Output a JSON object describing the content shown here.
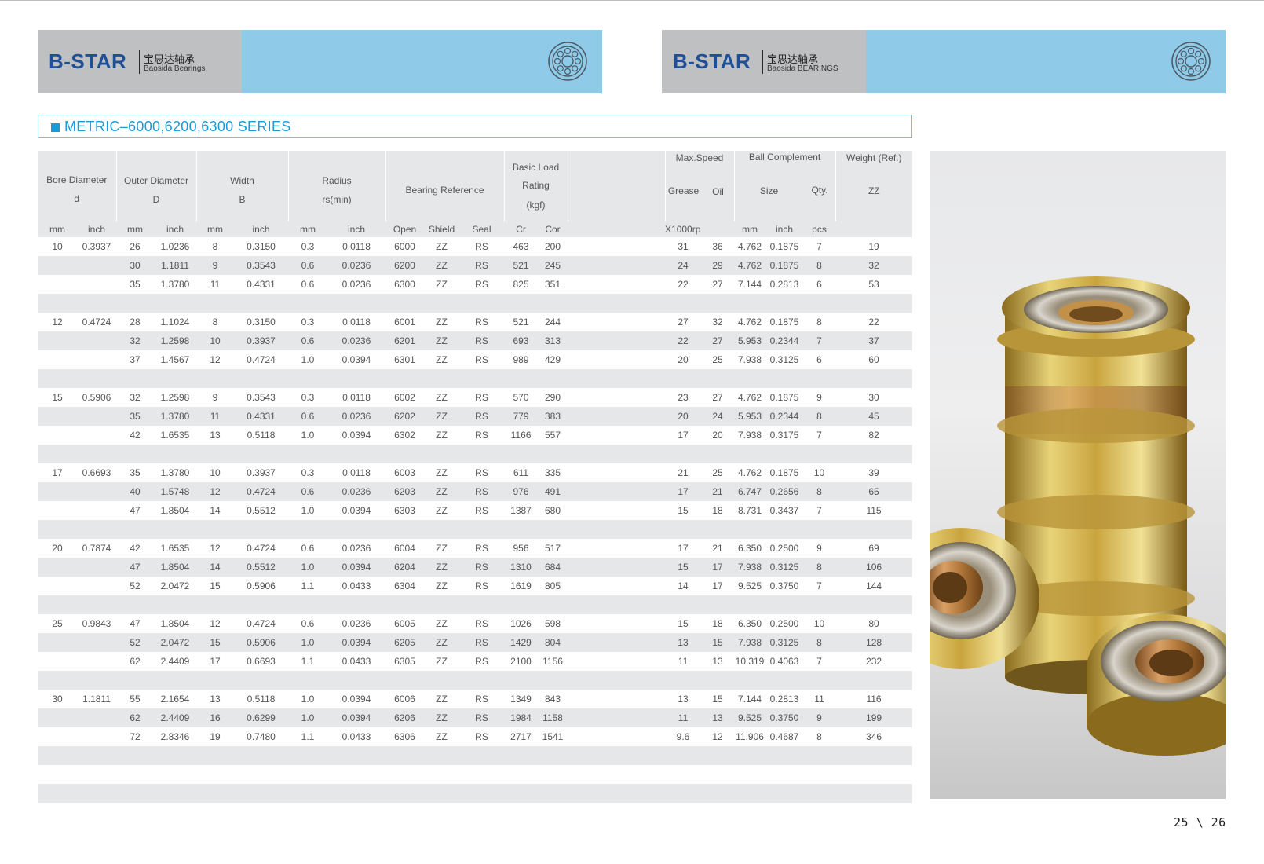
{
  "left_header": {
    "brand": "B-STAR",
    "cn": "宝思达轴承",
    "en": "Baosida Bearings"
  },
  "right_header": {
    "brand": "B-STAR",
    "cn": "宝思达轴承",
    "en": "Baosida BEARINGS"
  },
  "title": "METRIC–6000,6200,6300 SERIES",
  "colors": {
    "accent": "#1c9ad6",
    "header_blue": "#8fcbe8",
    "header_grey": "#bfc0c2",
    "row_grey": "#e6e7e8"
  },
  "headers": {
    "bore": [
      "Bore  Diameter",
      "d"
    ],
    "outer": [
      "Outer Diameter",
      "D"
    ],
    "width": [
      "Width",
      "B"
    ],
    "radius": [
      "Radius",
      "rs(min)"
    ],
    "reference": "Bearing Reference",
    "load": [
      "Basic Load",
      "Rating",
      "(kgf)"
    ],
    "maxspeed": "Max.Speed",
    "grease": "Grease",
    "oil": "Oil",
    "ballcomp": "Ball Complement",
    "size": "Size",
    "qty": "Qty.",
    "weight": "Weight  (Ref.)",
    "zz": "ZZ"
  },
  "units": [
    "mm",
    "inch",
    "mm",
    "inch",
    "mm",
    "inch",
    "mm",
    "inch",
    "Open",
    "Shield",
    "Seal",
    "Cr",
    "Cor",
    "",
    "X1000rpm",
    "",
    "mm",
    "inch",
    "pcs",
    ""
  ],
  "rows": [
    [
      "10",
      "0.3937",
      "26",
      "1.0236",
      "8",
      "0.3150",
      "0.3",
      "0.0118",
      "6000",
      "ZZ",
      "RS",
      "463",
      "200",
      "",
      "31",
      "36",
      "4.762",
      "0.1875",
      "7",
      "19"
    ],
    [
      "",
      "",
      "30",
      "1.1811",
      "9",
      "0.3543",
      "0.6",
      "0.0236",
      "6200",
      "ZZ",
      "RS",
      "521",
      "245",
      "",
      "24",
      "29",
      "4.762",
      "0.1875",
      "8",
      "32"
    ],
    [
      "",
      "",
      "35",
      "1.3780",
      "11",
      "0.4331",
      "0.6",
      "0.0236",
      "6300",
      "ZZ",
      "RS",
      "825",
      "351",
      "",
      "22",
      "27",
      "7.144",
      "0.2813",
      "6",
      "53"
    ],
    [
      "",
      "",
      "",
      "",
      "",
      "",
      "",
      "",
      "",
      "",
      "",
      "",
      "",
      "",
      "",
      "",
      "",
      "",
      "",
      ""
    ],
    [
      "12",
      "0.4724",
      "28",
      "1.1024",
      "8",
      "0.3150",
      "0.3",
      "0.0118",
      "6001",
      "ZZ",
      "RS",
      "521",
      "244",
      "",
      "27",
      "32",
      "4.762",
      "0.1875",
      "8",
      "22"
    ],
    [
      "",
      "",
      "32",
      "1.2598",
      "10",
      "0.3937",
      "0.6",
      "0.0236",
      "6201",
      "ZZ",
      "RS",
      "693",
      "313",
      "",
      "22",
      "27",
      "5.953",
      "0.2344",
      "7",
      "37"
    ],
    [
      "",
      "",
      "37",
      "1.4567",
      "12",
      "0.4724",
      "1.0",
      "0.0394",
      "6301",
      "ZZ",
      "RS",
      "989",
      "429",
      "",
      "20",
      "25",
      "7.938",
      "0.3125",
      "6",
      "60"
    ],
    [
      "",
      "",
      "",
      "",
      "",
      "",
      "",
      "",
      "",
      "",
      "",
      "",
      "",
      "",
      "",
      "",
      "",
      "",
      "",
      ""
    ],
    [
      "15",
      "0.5906",
      "32",
      "1.2598",
      "9",
      "0.3543",
      "0.3",
      "0.0118",
      "6002",
      "ZZ",
      "RS",
      "570",
      "290",
      "",
      "23",
      "27",
      "4.762",
      "0.1875",
      "9",
      "30"
    ],
    [
      "",
      "",
      "35",
      "1.3780",
      "11",
      "0.4331",
      "0.6",
      "0.0236",
      "6202",
      "ZZ",
      "RS",
      "779",
      "383",
      "",
      "20",
      "24",
      "5.953",
      "0.2344",
      "8",
      "45"
    ],
    [
      "",
      "",
      "42",
      "1.6535",
      "13",
      "0.5118",
      "1.0",
      "0.0394",
      "6302",
      "ZZ",
      "RS",
      "1166",
      "557",
      "",
      "17",
      "20",
      "7.938",
      "0.3175",
      "7",
      "82"
    ],
    [
      "",
      "",
      "",
      "",
      "",
      "",
      "",
      "",
      "",
      "",
      "",
      "",
      "",
      "",
      "",
      "",
      "",
      "",
      "",
      ""
    ],
    [
      "17",
      "0.6693",
      "35",
      "1.3780",
      "10",
      "0.3937",
      "0.3",
      "0.0118",
      "6003",
      "ZZ",
      "RS",
      "611",
      "335",
      "",
      "21",
      "25",
      "4.762",
      "0.1875",
      "10",
      "39"
    ],
    [
      "",
      "",
      "40",
      "1.5748",
      "12",
      "0.4724",
      "0.6",
      "0.0236",
      "6203",
      "ZZ",
      "RS",
      "976",
      "491",
      "",
      "17",
      "21",
      "6.747",
      "0.2656",
      "8",
      "65"
    ],
    [
      "",
      "",
      "47",
      "1.8504",
      "14",
      "0.5512",
      "1.0",
      "0.0394",
      "6303",
      "ZZ",
      "RS",
      "1387",
      "680",
      "",
      "15",
      "18",
      "8.731",
      "0.3437",
      "7",
      "115"
    ],
    [
      "",
      "",
      "",
      "",
      "",
      "",
      "",
      "",
      "",
      "",
      "",
      "",
      "",
      "",
      "",
      "",
      "",
      "",
      "",
      ""
    ],
    [
      "20",
      "0.7874",
      "42",
      "1.6535",
      "12",
      "0.4724",
      "0.6",
      "0.0236",
      "6004",
      "ZZ",
      "RS",
      "956",
      "517",
      "",
      "17",
      "21",
      "6.350",
      "0.2500",
      "9",
      "69"
    ],
    [
      "",
      "",
      "47",
      "1.8504",
      "14",
      "0.5512",
      "1.0",
      "0.0394",
      "6204",
      "ZZ",
      "RS",
      "1310",
      "684",
      "",
      "15",
      "17",
      "7.938",
      "0.3125",
      "8",
      "106"
    ],
    [
      "",
      "",
      "52",
      "2.0472",
      "15",
      "0.5906",
      "1.1",
      "0.0433",
      "6304",
      "ZZ",
      "RS",
      "1619",
      "805",
      "",
      "14",
      "17",
      "9.525",
      "0.3750",
      "7",
      "144"
    ],
    [
      "",
      "",
      "",
      "",
      "",
      "",
      "",
      "",
      "",
      "",
      "",
      "",
      "",
      "",
      "",
      "",
      "",
      "",
      "",
      ""
    ],
    [
      "25",
      "0.9843",
      "47",
      "1.8504",
      "12",
      "0.4724",
      "0.6",
      "0.0236",
      "6005",
      "ZZ",
      "RS",
      "1026",
      "598",
      "",
      "15",
      "18",
      "6.350",
      "0.2500",
      "10",
      "80"
    ],
    [
      "",
      "",
      "52",
      "2.0472",
      "15",
      "0.5906",
      "1.0",
      "0.0394",
      "6205",
      "ZZ",
      "RS",
      "1429",
      "804",
      "",
      "13",
      "15",
      "7.938",
      "0.3125",
      "8",
      "128"
    ],
    [
      "",
      "",
      "62",
      "2.4409",
      "17",
      "0.6693",
      "1.1",
      "0.0433",
      "6305",
      "ZZ",
      "RS",
      "2100",
      "1156",
      "",
      "11",
      "13",
      "10.319",
      "0.4063",
      "7",
      "232"
    ],
    [
      "",
      "",
      "",
      "",
      "",
      "",
      "",
      "",
      "",
      "",
      "",
      "",
      "",
      "",
      "",
      "",
      "",
      "",
      "",
      ""
    ],
    [
      "30",
      "1.1811",
      "55",
      "2.1654",
      "13",
      "0.5118",
      "1.0",
      "0.0394",
      "6006",
      "ZZ",
      "RS",
      "1349",
      "843",
      "",
      "13",
      "15",
      "7.144",
      "0.2813",
      "11",
      "116"
    ],
    [
      "",
      "",
      "62",
      "2.4409",
      "16",
      "0.6299",
      "1.0",
      "0.0394",
      "6206",
      "ZZ",
      "RS",
      "1984",
      "1158",
      "",
      "11",
      "13",
      "9.525",
      "0.3750",
      "9",
      "199"
    ],
    [
      "",
      "",
      "72",
      "2.8346",
      "19",
      "0.7480",
      "1.1",
      "0.0433",
      "6306",
      "ZZ",
      "RS",
      "2717",
      "1541",
      "",
      "9.6",
      "12",
      "11.906",
      "0.4687",
      "8",
      "346"
    ],
    [
      "",
      "",
      "",
      "",
      "",
      "",
      "",
      "",
      "",
      "",
      "",
      "",
      "",
      "",
      "",
      "",
      "",
      "",
      "",
      ""
    ],
    [
      "",
      "",
      "",
      "",
      "",
      "",
      "",
      "",
      "",
      "",
      "",
      "",
      "",
      "",
      "",
      "",
      "",
      "",
      "",
      ""
    ],
    [
      "",
      "",
      "",
      "",
      "",
      "",
      "",
      "",
      "",
      "",
      "",
      "",
      "",
      "",
      "",
      "",
      "",
      "",
      "",
      ""
    ]
  ],
  "page_number": "25 \\ 26"
}
